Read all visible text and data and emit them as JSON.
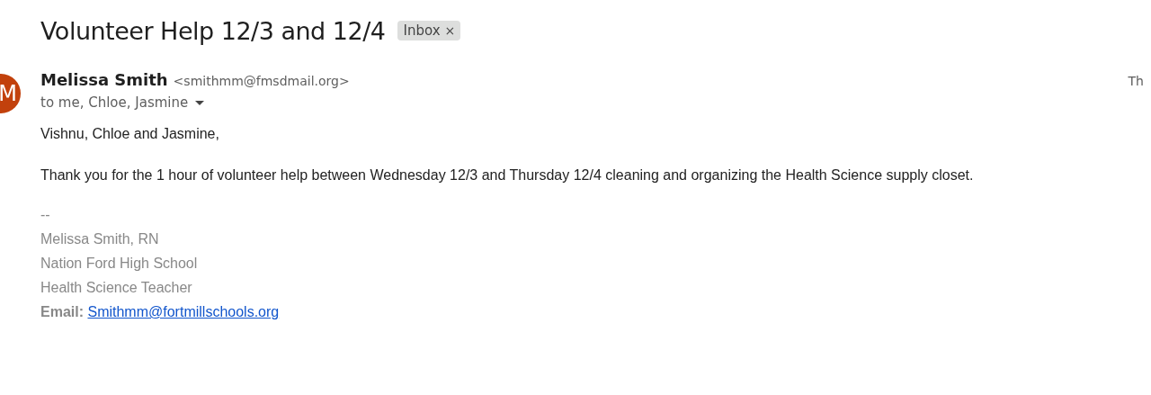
{
  "subject": "Volunteer Help 12/3 and 12/4",
  "labels": [
    {
      "text": "Inbox",
      "remove": "×"
    }
  ],
  "sender": {
    "avatar_letter": "M",
    "name": "Melissa Smith",
    "email": "<smithmm@fmsdmail.org>",
    "recipients": "to me, Chloe, Jasmine",
    "date": "Th"
  },
  "body": [
    "Vishnu, Chloe and Jasmine,",
    "Thank you for the 1 hour of volunteer help between Wednesday 12/3 and Thursday 12/4 cleaning and organizing the Health Science supply closet."
  ],
  "signature": {
    "separator": "--",
    "lines": [
      "Melissa Smith, RN",
      "Nation Ford High School",
      "Health Science Teacher"
    ],
    "email_label": "Email:",
    "email_link": "Smithmm@fortmillschools.org"
  }
}
